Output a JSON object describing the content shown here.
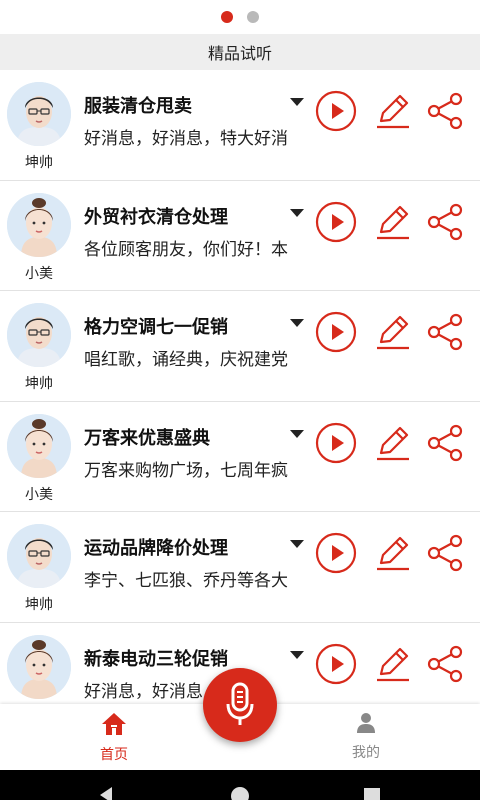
{
  "pager": {
    "count": 2,
    "active_index": 0
  },
  "section_title": "精品试听",
  "colors": {
    "accent": "#d72a1b",
    "divider": "#e2e2e2",
    "header_bg": "#eeeeee"
  },
  "items": [
    {
      "title": "服装清仓甩卖",
      "preview": "好消息，好消息，特大好消",
      "speaker": "坤帅",
      "avatar": "male-avatar"
    },
    {
      "title": "外贸衬衣清仓处理",
      "preview": "各位顾客朋友，你们好！本",
      "speaker": "小美",
      "avatar": "female-avatar"
    },
    {
      "title": "格力空调七一促销",
      "preview": "唱红歌，诵经典，庆祝建党",
      "speaker": "坤帅",
      "avatar": "male-avatar"
    },
    {
      "title": "万客来优惠盛典",
      "preview": "万客来购物广场，七周年疯",
      "speaker": "小美",
      "avatar": "female-avatar"
    },
    {
      "title": "运动品牌降价处理",
      "preview": "李宁、七匹狼、乔丹等各大",
      "speaker": "坤帅",
      "avatar": "male-avatar"
    },
    {
      "title": "新泰电动三轮促销",
      "preview": "好消息，好消息，新泰电",
      "speaker": "小美",
      "avatar": "female-avatar"
    }
  ],
  "item_icons": {
    "play": "play-circle-icon",
    "edit": "pencil-icon",
    "share": "share-icon",
    "more": "dropdown-caret-icon"
  },
  "nav": {
    "home": {
      "label": "首页",
      "icon": "home-icon"
    },
    "mine": {
      "label": "我的",
      "icon": "person-icon"
    },
    "mic": {
      "icon": "microphone-icon"
    }
  },
  "system_bar": {
    "icons": [
      "back-icon",
      "home-circle-icon",
      "recent-apps-icon"
    ]
  }
}
